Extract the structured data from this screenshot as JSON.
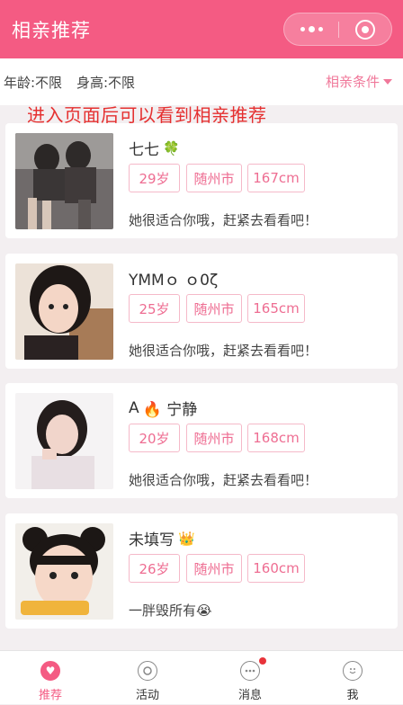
{
  "navbar": {
    "title": "相亲推荐"
  },
  "filters": {
    "age": "年龄:不限",
    "height": "身高:不限",
    "conditions_label": "相亲条件"
  },
  "annotation": "进入页面后可以看到相亲推荐",
  "cards": [
    {
      "name": "七七",
      "name_emoji": "🍀",
      "age": "29岁",
      "city": "随州市",
      "height": "167cm",
      "intro": "她很适合你哦，赶紧去看看吧！"
    },
    {
      "name": "YMMｏ ｏ0ζ",
      "name_emoji": "",
      "age": "25岁",
      "city": "随州市",
      "height": "165cm",
      "intro": "她很适合你哦，赶紧去看看吧！"
    },
    {
      "name": "A",
      "name_emoji": "🔥 宁静",
      "age": "20岁",
      "city": "随州市",
      "height": "168cm",
      "intro": "她很适合你哦，赶紧去看看吧！"
    },
    {
      "name": "未填写",
      "name_emoji": "👑",
      "age": "26岁",
      "city": "随州市",
      "height": "160cm",
      "intro": "一胖毁所有😭"
    }
  ],
  "tabbar": [
    {
      "label": "推荐",
      "icon": "heart-icon",
      "active": true
    },
    {
      "label": "活动",
      "icon": "target-icon",
      "active": false
    },
    {
      "label": "消息",
      "icon": "chat-icon",
      "active": false,
      "badge": true
    },
    {
      "label": "我",
      "icon": "smile-icon",
      "active": false
    }
  ],
  "colors": {
    "brand": "#f45b83",
    "tag_text": "#ee6d92",
    "tag_border": "#f5b9c9",
    "annotation": "#e53030"
  }
}
